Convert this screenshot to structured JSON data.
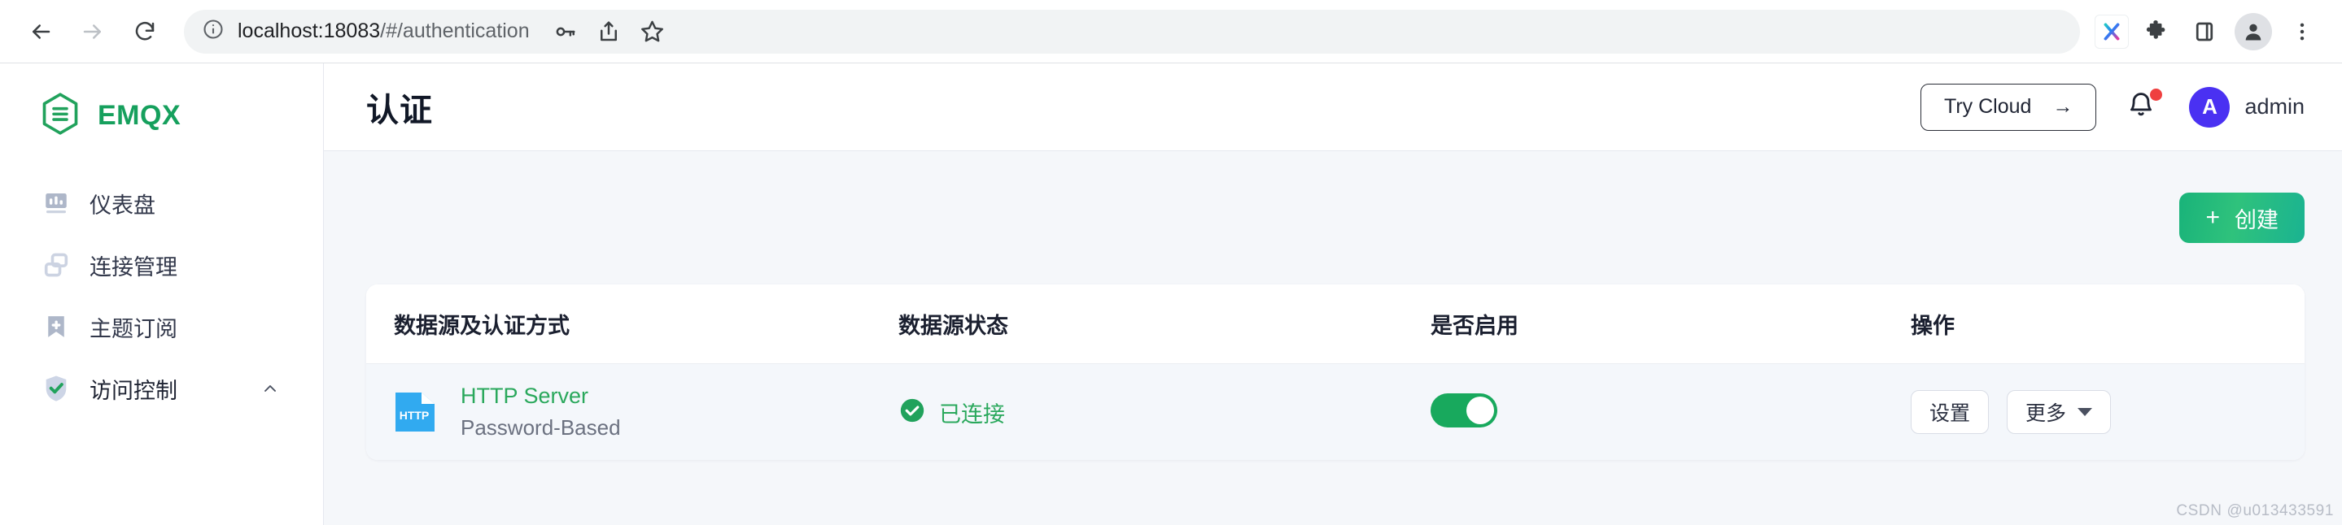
{
  "browser": {
    "back_icon": "back-arrow-icon",
    "forward_icon": "forward-arrow-icon",
    "reload_icon": "reload-icon",
    "site_info_icon": "info-circle-icon",
    "url_host": "localhost:18083",
    "url_path": "/#/authentication",
    "url_full": "localhost:18083/#/authentication",
    "toolbar_icons": [
      "password-key-icon",
      "share-icon",
      "bookmark-star-icon",
      "extension-x-icon",
      "extensions-puzzle-icon",
      "side-panel-icon",
      "profile-avatar-icon",
      "kebab-menu-icon"
    ],
    "extension_badge_label": "X"
  },
  "sidebar": {
    "brand": "EMQX",
    "brand_color": "#16a05d",
    "items": [
      {
        "label": "仪表盘",
        "icon": "dashboard-chart-icon",
        "active": false
      },
      {
        "label": "连接管理",
        "icon": "connections-icon",
        "active": false
      },
      {
        "label": "主题订阅",
        "icon": "topic-bookmark-plus-icon",
        "active": false
      },
      {
        "label": "访问控制",
        "icon": "shield-check-icon",
        "active": true,
        "expanded": true
      }
    ]
  },
  "header": {
    "title": "认证",
    "try_cloud_label": "Try Cloud",
    "try_cloud_arrow": "→",
    "notification_icon": "bell-icon",
    "has_notification": true,
    "user_initial": "A",
    "user_name": "admin",
    "avatar_color": "#4a31f2"
  },
  "toolbar": {
    "create_label": "创建",
    "create_plus": "+",
    "create_color": "#1ab37d"
  },
  "table": {
    "columns": [
      {
        "key": "source",
        "label": "数据源及认证方式"
      },
      {
        "key": "status",
        "label": "数据源状态"
      },
      {
        "key": "enabled",
        "label": "是否启用"
      },
      {
        "key": "actions",
        "label": "操作"
      }
    ],
    "rows": [
      {
        "icon_label": "HTTP",
        "icon_color": "#31aaf0",
        "name": "HTTP Server",
        "name_color": "#2aa85c",
        "mechanism": "Password-Based",
        "status_text": "已连接",
        "status_color": "#2aa85c",
        "status_icon": "check-circle-icon",
        "enabled": true,
        "settings_label": "设置",
        "more_label": "更多"
      }
    ]
  },
  "watermark": "CSDN @u013433591"
}
